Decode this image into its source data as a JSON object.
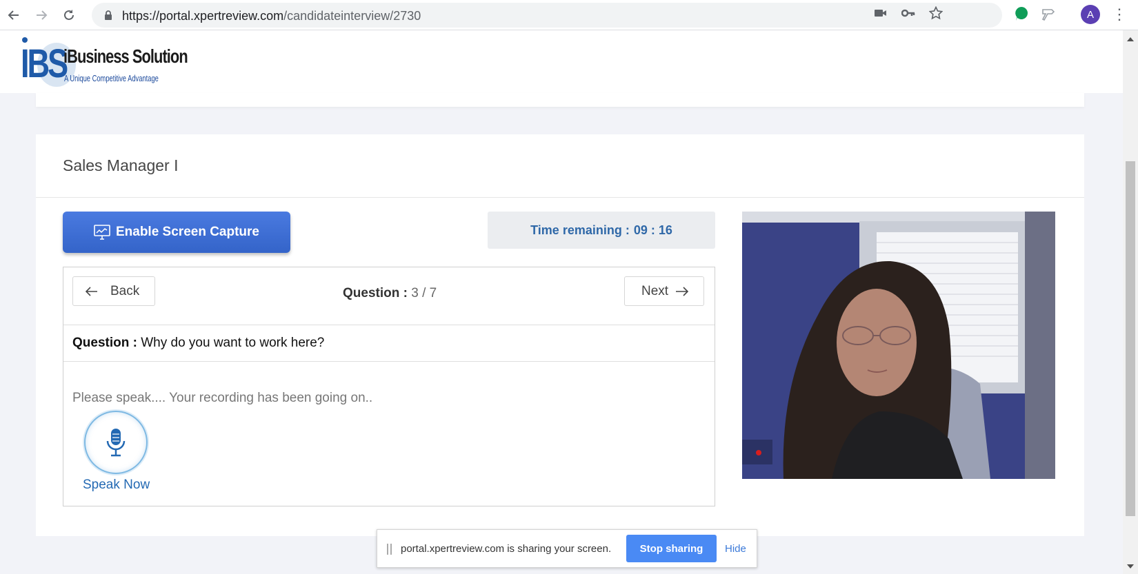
{
  "browser": {
    "url_host": "https://portal.xpertreview.com",
    "url_path": "/candidateinterview/2730",
    "profile_initial": "A"
  },
  "brand": {
    "name": "iBusiness Solution",
    "tagline": "A Unique Competitive Advantage",
    "logo_letters": "IBS"
  },
  "interview": {
    "title": "Sales Manager I",
    "capture_button": "Enable Screen Capture",
    "timer_label": "Time remaining :",
    "timer_value": "09 : 16",
    "back_label": "Back",
    "next_label": "Next",
    "counter_label": "Question :",
    "counter_value": "3 / 7",
    "question_label": "Question :",
    "question_text": "Why do you want to work here?",
    "recording_msg": "Please speak.... Your recording has been going on..",
    "speak_label": "Speak Now"
  },
  "share_bar": {
    "message": "portal.xpertreview.com is sharing your screen.",
    "stop_label": "Stop sharing",
    "hide_label": "Hide"
  },
  "colors": {
    "accent_blue": "#3e6fd6",
    "timer_text": "#2f68a8",
    "speak_blue": "#2369b3",
    "share_blue": "#4a8af4"
  }
}
